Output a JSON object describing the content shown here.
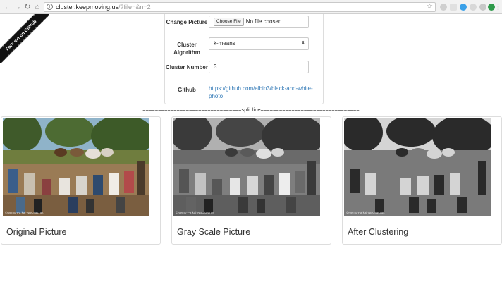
{
  "browser": {
    "url_host": "cluster.keepmoving.us",
    "url_query": "/?file=&n=2"
  },
  "ribbon": {
    "label": "Fork me on GitHub"
  },
  "form": {
    "picture_label": "Change Picture",
    "file_button": "Choose File",
    "file_status": "No file chosen",
    "algorithm_label": "Cluster Algorithm",
    "algorithm_value": "k-means",
    "number_label": "Cluster Number",
    "number_value": "3",
    "github_label": "Github",
    "github_link": "https://github.com/albin3/black-and-white-photo"
  },
  "split_line": "================================split line================================",
  "cards": [
    {
      "title": "Original Picture"
    },
    {
      "title": "Gray Scale Picture"
    },
    {
      "title": "After Clustering"
    }
  ],
  "photo_watermark": "©Nemo·Pa kai·NBCsay.net",
  "colors": {
    "link": "#337ab7",
    "ribbon": "#111111",
    "border": "#dddddd"
  }
}
